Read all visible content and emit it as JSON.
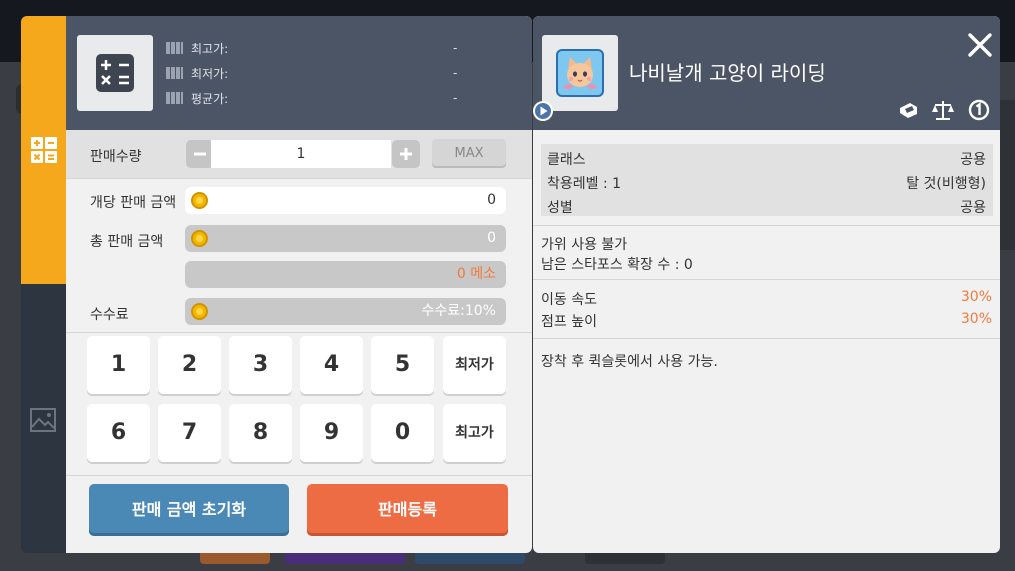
{
  "side_tabs": {
    "calculator_icon": "calculator-icon",
    "image_icon": "image-icon"
  },
  "left": {
    "calc_icon": "calculator-icon",
    "prices": [
      {
        "label": "최고가:",
        "value": "-"
      },
      {
        "label": "최저가:",
        "value": "-"
      },
      {
        "label": "평균가:",
        "value": "-"
      }
    ],
    "quantity_label": "판매수량",
    "quantity_value": "1",
    "max_label": "MAX",
    "unit_price_label": "개당 판매 금액",
    "unit_price_value": "0",
    "total_price_label": "총 판매 금액",
    "total_price_value": "0",
    "meso_text": "0 메소",
    "fee_label": "수수료",
    "fee_value": "수수료:10%",
    "keypad_row1": [
      "1",
      "2",
      "3",
      "4",
      "5",
      "최저가"
    ],
    "keypad_row2": [
      "6",
      "7",
      "8",
      "9",
      "0",
      "최고가"
    ],
    "reset_label": "판매 금액 초기화",
    "register_label": "판매등록"
  },
  "right": {
    "item_title": "나비날개 고양이 라이딩",
    "attributes": [
      {
        "label": "클래스",
        "value": "공용"
      },
      {
        "label": "착용레벨 : 1",
        "value": "탈 것(비행형)"
      },
      {
        "label": "성별",
        "value": "공용"
      }
    ],
    "info_line1": "가위 사용 불가",
    "info_line2": "남은 스타포스 확장 수 : 0",
    "stats": [
      {
        "label": "이동 속도",
        "value": "30%"
      },
      {
        "label": "점프 높이",
        "value": "30%"
      }
    ],
    "description": "장착 후 퀵슬롯에서 사용 가능."
  },
  "colors": {
    "accent_orange": "#f5a81c",
    "header_slate": "#4c5566",
    "register": "#ed6c44",
    "reset": "#4a88b6",
    "stat_value": "#f07a3f"
  }
}
